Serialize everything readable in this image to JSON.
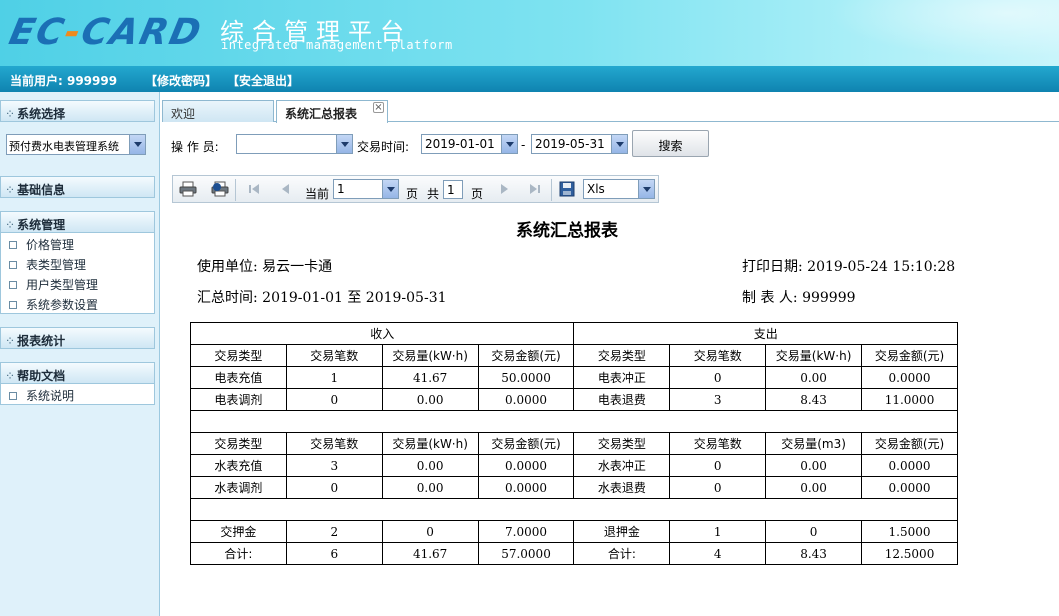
{
  "header": {
    "logo_part1": "EC",
    "logo_dash": "-",
    "logo_part2": "CARD",
    "title_cn": "综合管理平台",
    "title_en": "integrated management platform"
  },
  "userbar": {
    "current_user": "当前用户: 999999",
    "change_password": "【修改密码】",
    "logout": "【安全退出】"
  },
  "sidebar": {
    "system_select_title": "系统选择",
    "system_select_value": "预付费水电表管理系统",
    "basic_info_title": "基础信息",
    "system_manage_title": "系统管理",
    "system_manage_items": [
      "价格管理",
      "表类型管理",
      "用户类型管理",
      "系统参数设置"
    ],
    "report_title": "报表统计",
    "help_title": "帮助文档",
    "help_items": [
      "系统说明"
    ]
  },
  "tabs": {
    "welcome": "欢迎",
    "report": "系统汇总报表",
    "close": "×"
  },
  "search": {
    "operator_label": "操 作 员:",
    "operator_value": "",
    "time_label": "交易时间:",
    "start_date": "2019-01-01",
    "dash": "-",
    "end_date": "2019-05-31",
    "search_button": "搜索"
  },
  "toolbar": {
    "current_label": "当前",
    "current_page": "1",
    "page_label": "页",
    "total_label": "共",
    "total_pages": "1",
    "page_label2": "页",
    "export_format": "Xls"
  },
  "report": {
    "title": "系统汇总报表",
    "unit_label": "使用单位:",
    "unit_value": "易云一卡通",
    "print_date_label": "打印日期:",
    "print_date_value": "2019-05-24 15:10:28",
    "period_label": "汇总时间:",
    "period_value": "2019-01-01 至 2019-05-31",
    "maker_label": "制 表 人:",
    "maker_value": "999999",
    "income_header": "收入",
    "expense_header": "支出",
    "elec_header": [
      "交易类型",
      "交易笔数",
      "交易量(kW·h)",
      "交易金额(元)",
      "交易类型",
      "交易笔数",
      "交易量(kW·h)",
      "交易金额(元)"
    ],
    "elec_rows": [
      [
        "电表充值",
        "1",
        "41.67",
        "50.0000",
        "电表冲正",
        "0",
        "0.00",
        "0.0000"
      ],
      [
        "电表调剂",
        "0",
        "0.00",
        "0.0000",
        "电表退费",
        "3",
        "8.43",
        "11.0000"
      ]
    ],
    "water_header": [
      "交易类型",
      "交易笔数",
      "交易量(kW·h)",
      "交易金额(元)",
      "交易类型",
      "交易笔数",
      "交易量(m3)",
      "交易金额(元)"
    ],
    "water_rows": [
      [
        "水表充值",
        "3",
        "0.00",
        "0.0000",
        "水表冲正",
        "0",
        "0.00",
        "0.0000"
      ],
      [
        "水表调剂",
        "0",
        "0.00",
        "0.0000",
        "水表退费",
        "0",
        "0.00",
        "0.0000"
      ]
    ],
    "deposit_rows": [
      [
        "交押金",
        "2",
        "0",
        "7.0000",
        "退押金",
        "1",
        "0",
        "1.5000"
      ],
      [
        "合计:",
        "6",
        "41.67",
        "57.0000",
        "合计:",
        "4",
        "8.43",
        "12.5000"
      ]
    ]
  }
}
